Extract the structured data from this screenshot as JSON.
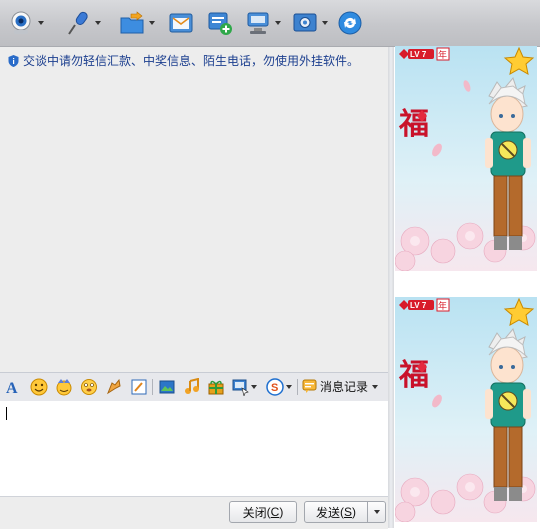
{
  "toolbar": {
    "items": [
      {
        "icon": "video-call-icon",
        "has_dropdown": true
      },
      {
        "icon": "voice-call-icon",
        "has_dropdown": true
      },
      {
        "icon": "send-file-icon",
        "has_dropdown": true
      },
      {
        "icon": "send-email-icon",
        "has_dropdown": false
      },
      {
        "icon": "create-group-icon",
        "has_dropdown": false
      },
      {
        "icon": "remote-assist-icon",
        "has_dropdown": true
      },
      {
        "icon": "apps-icon",
        "has_dropdown": true
      },
      {
        "icon": "refresh-icon",
        "has_dropdown": false
      }
    ]
  },
  "notice": {
    "text": "交谈中请勿轻信汇款、中奖信息、陌生电话，勿使用外挂软件。"
  },
  "format_bar": {
    "history_label": "消息记录"
  },
  "buttons": {
    "close_label": "关闭",
    "close_key": "C",
    "send_label": "发送",
    "send_key": "S"
  },
  "show_panel": {
    "level_text": "LV 7",
    "year_badge": "年",
    "fu_char": "福"
  },
  "colors": {
    "notice_text": "#1c3f8f",
    "panel_sky": "#b9e2f2",
    "shirt": "#1f9a8a"
  }
}
